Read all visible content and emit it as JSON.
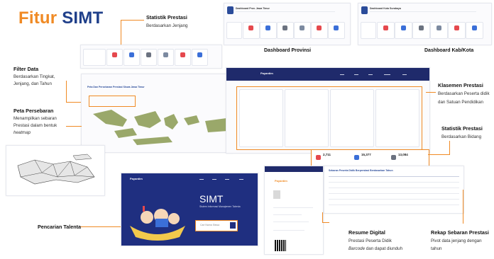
{
  "title": {
    "part1": "Fitur",
    "part2": "SIMT"
  },
  "callouts": {
    "statistik": {
      "heading": "Statistik Prestasi",
      "text": "Berdasarkan Jenjang"
    },
    "provinsi": {
      "heading": "Dashboard Provinsi"
    },
    "kabkota": {
      "heading": "Dashboard Kab/Kota"
    },
    "filter": {
      "heading": "Filter Data",
      "line1": "Berdasarkan Tingkat,",
      "line2": "Jenjang, dan Tahun"
    },
    "klasemen": {
      "heading": "Klasemen Prestasi",
      "line1": "Berdasarkan Peserta didik",
      "line2": "dan Satuan Pendidikan"
    },
    "peta": {
      "heading": "Peta Persebaran",
      "line1": "Menampilkan sebaran",
      "line2": "Prestasi dalam bentuk",
      "line3": "heatmap"
    },
    "bidang": {
      "heading": "Statistik Prestasi",
      "text": "Berdasarkan Bidang"
    },
    "talenta": {
      "heading": "Pencarian Talenta"
    },
    "resume": {
      "heading": "Resume Digital",
      "line1": "Prestasi Peserta Didik",
      "line2a": "Barcode",
      "line2b": " dan dapat diunduh"
    },
    "rekap": {
      "heading": "Rekap Sebaran Prestasi",
      "line1": "Pivot data jenjang dengan",
      "line2": "tahun"
    }
  },
  "screens": {
    "prov_header": "Dashboard Prov. Jawa Timur",
    "kab_header": "Dashboard Kota Surabaya",
    "map_title": "Peta Dan Persebaran Prestasi Siswa Jawa Timur",
    "brand": "Payantim",
    "simt_title": "SIMT",
    "simt_sub": "Sistem Informasi Manajemen Talenta",
    "search_placeholder": "Cari Nama Siswa",
    "stat_1": "2,711",
    "stat_2": "15,377",
    "stat_3": "13,084",
    "rekap_title": "Sebaran Peserta Didik Berprestasi Berdasarkan Tahun"
  },
  "colors": {
    "accent": "#f08a24",
    "brand_blue": "#1f3f8a",
    "nav_dark": "#1f2a6b"
  }
}
